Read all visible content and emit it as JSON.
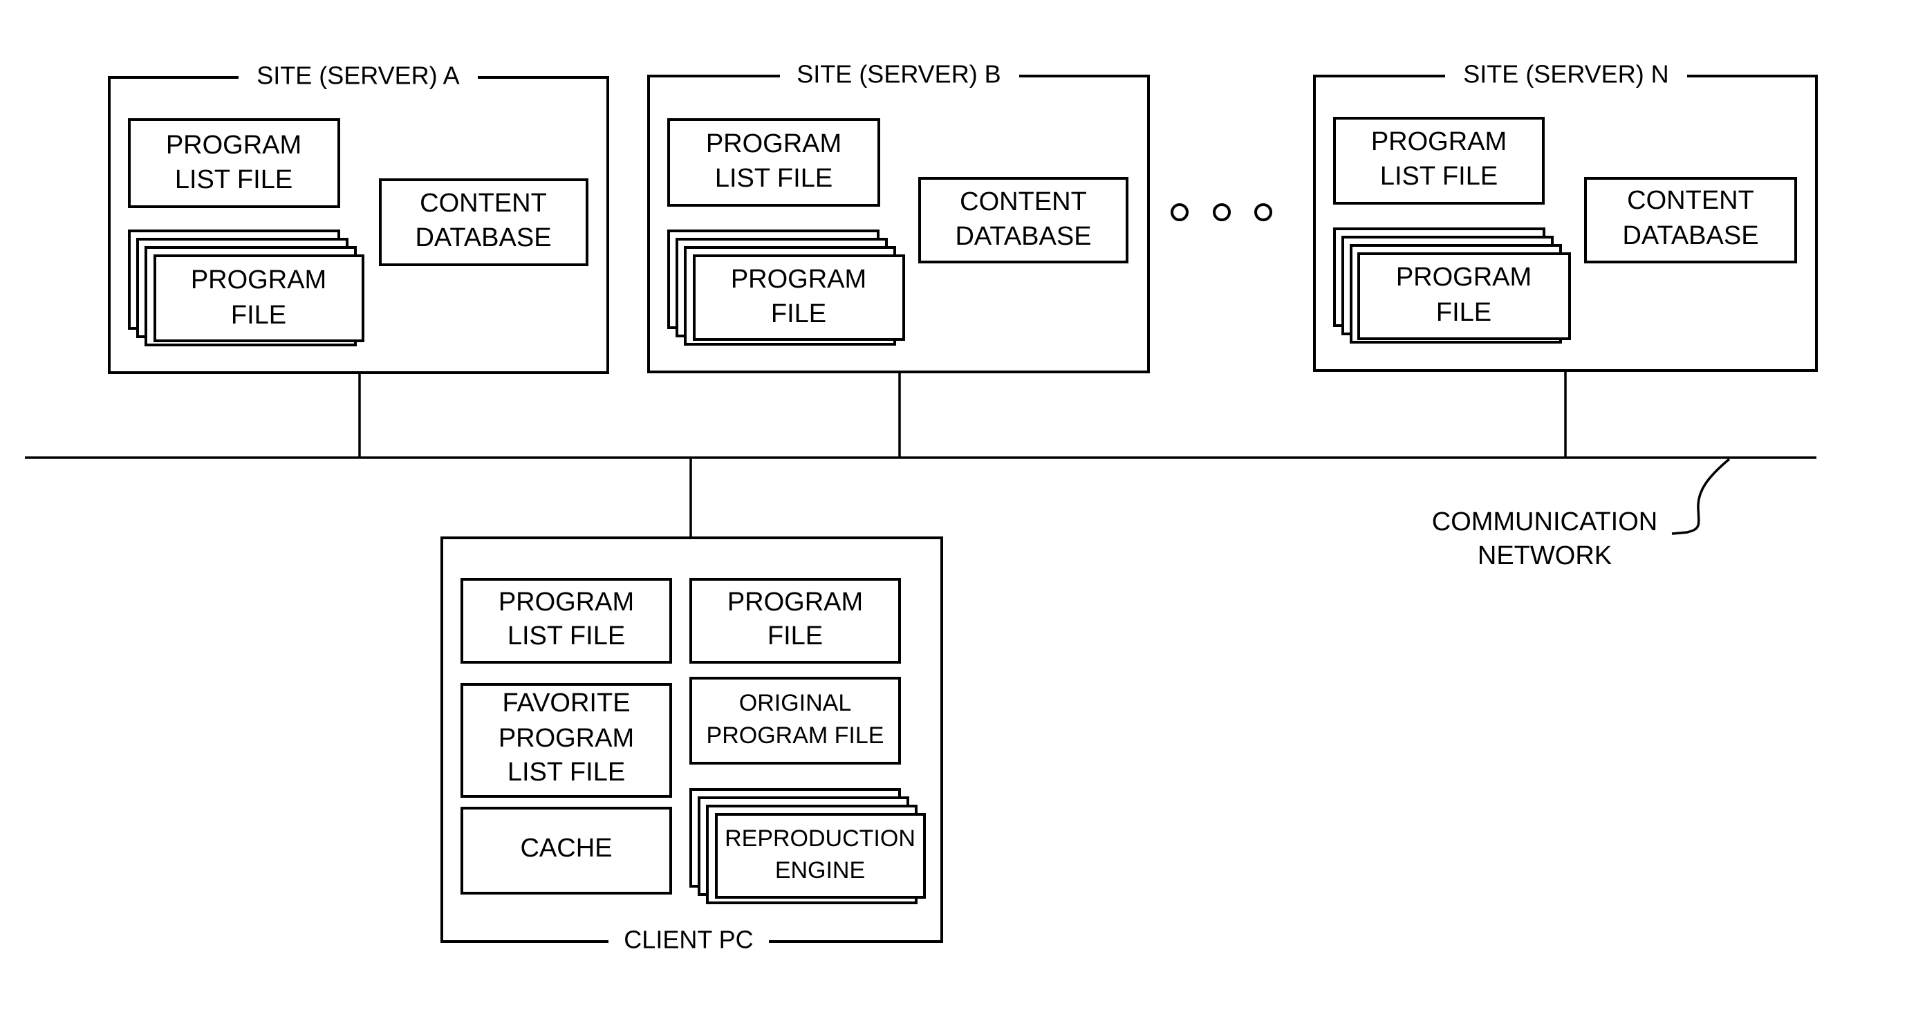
{
  "diagram": {
    "sites": [
      {
        "title": "SITE (SERVER) A",
        "program_list_file": [
          "PROGRAM",
          "LIST FILE"
        ],
        "content_database": [
          "CONTENT",
          "DATABASE"
        ],
        "program_file": [
          "PROGRAM",
          "FILE"
        ]
      },
      {
        "title": "SITE (SERVER) B",
        "program_list_file": [
          "PROGRAM",
          "LIST FILE"
        ],
        "content_database": [
          "CONTENT",
          "DATABASE"
        ],
        "program_file": [
          "PROGRAM",
          "FILE"
        ]
      },
      {
        "title": "SITE (SERVER) N",
        "program_list_file": [
          "PROGRAM",
          "LIST FILE"
        ],
        "content_database": [
          "CONTENT",
          "DATABASE"
        ],
        "program_file": [
          "PROGRAM",
          "FILE"
        ]
      }
    ],
    "ellipsis_icon": "three-dots",
    "network_label": [
      "COMMUNICATION",
      "NETWORK"
    ],
    "client": {
      "title": "CLIENT PC",
      "program_list_file": [
        "PROGRAM",
        "LIST FILE"
      ],
      "program_file": [
        "PROGRAM",
        "FILE"
      ],
      "favorite_program_list_file": [
        "FAVORITE",
        "PROGRAM",
        "LIST FILE"
      ],
      "original_program_file": [
        "ORIGINAL",
        "PROGRAM FILE"
      ],
      "cache": [
        "CACHE"
      ],
      "reproduction_engine": [
        "REPRODUCTION",
        "ENGINE"
      ]
    }
  }
}
